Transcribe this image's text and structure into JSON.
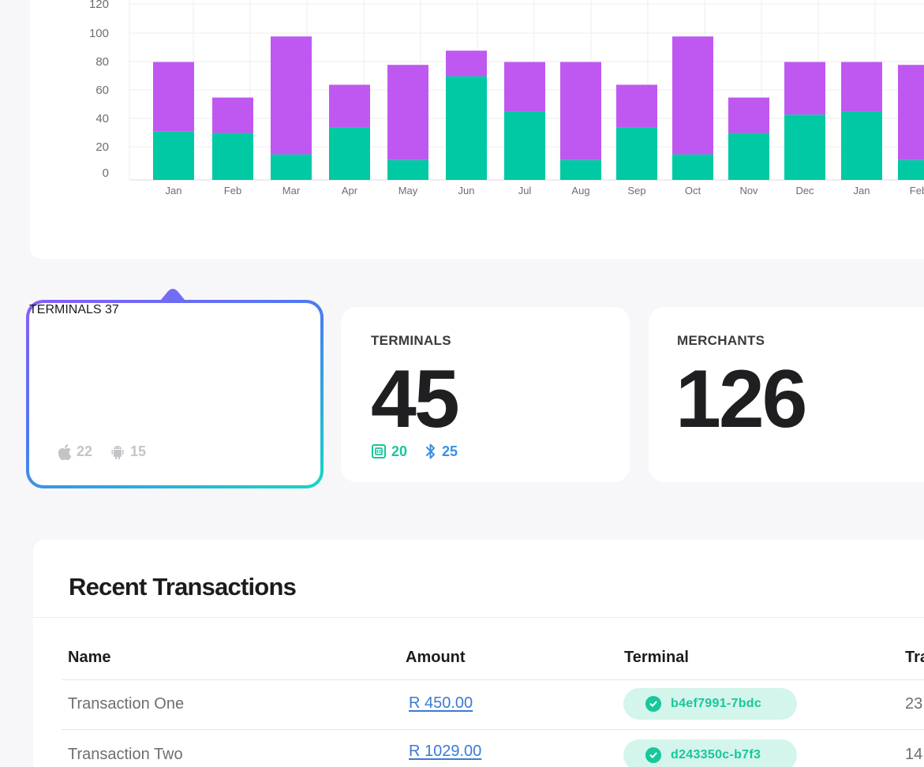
{
  "chart_data": {
    "type": "bar",
    "stacked": true,
    "categories": [
      "Jan",
      "Feb",
      "Mar",
      "Apr",
      "May",
      "Jun",
      "Jul",
      "Aug",
      "Sep",
      "Oct",
      "Nov",
      "Dec",
      "Jan",
      "Feb"
    ],
    "y_ticks": [
      "0",
      "20",
      "40",
      "60",
      "80",
      "100",
      "120"
    ],
    "ylim": [
      0,
      125
    ],
    "grid": true,
    "series": [
      {
        "color": "#00c9a3",
        "values": [
          34,
          33,
          18,
          37,
          14,
          73,
          48,
          14,
          37,
          18,
          33,
          46,
          48,
          14
        ]
      },
      {
        "color": "#bf58f0",
        "values": [
          49,
          25,
          83,
          30,
          67,
          18,
          35,
          69,
          30,
          83,
          25,
          37,
          35,
          67
        ]
      }
    ]
  },
  "stats": [
    {
      "label": "TERMINALS",
      "value": "37",
      "sub": [
        {
          "icon": "apple-icon",
          "value": "22"
        },
        {
          "icon": "android-icon",
          "value": "15"
        }
      ],
      "selected": true
    },
    {
      "label": "TERMINALS",
      "value": "45",
      "sub": [
        {
          "icon": "nfc-terminal-icon",
          "value": "20"
        },
        {
          "icon": "bluetooth-icon",
          "value": "25"
        }
      ]
    },
    {
      "label": "MERCHANTS",
      "value": "126"
    }
  ],
  "colors": {
    "accent_green": "#18c79a",
    "accent_blue": "#3c7ad6",
    "muted": "#c4c4c8"
  },
  "transactions": {
    "title": "Recent Transactions",
    "columns": [
      "Name",
      "Amount",
      "Terminal",
      "Tra"
    ],
    "rows": [
      {
        "name": "Transaction One",
        "amount": "R 450.00",
        "terminal": "b4ef7991-7bdc",
        "extra": "23"
      },
      {
        "name": "Transaction Two",
        "amount": "R 1029.00",
        "terminal": "d243350c-b7f3",
        "extra": "14"
      }
    ]
  }
}
